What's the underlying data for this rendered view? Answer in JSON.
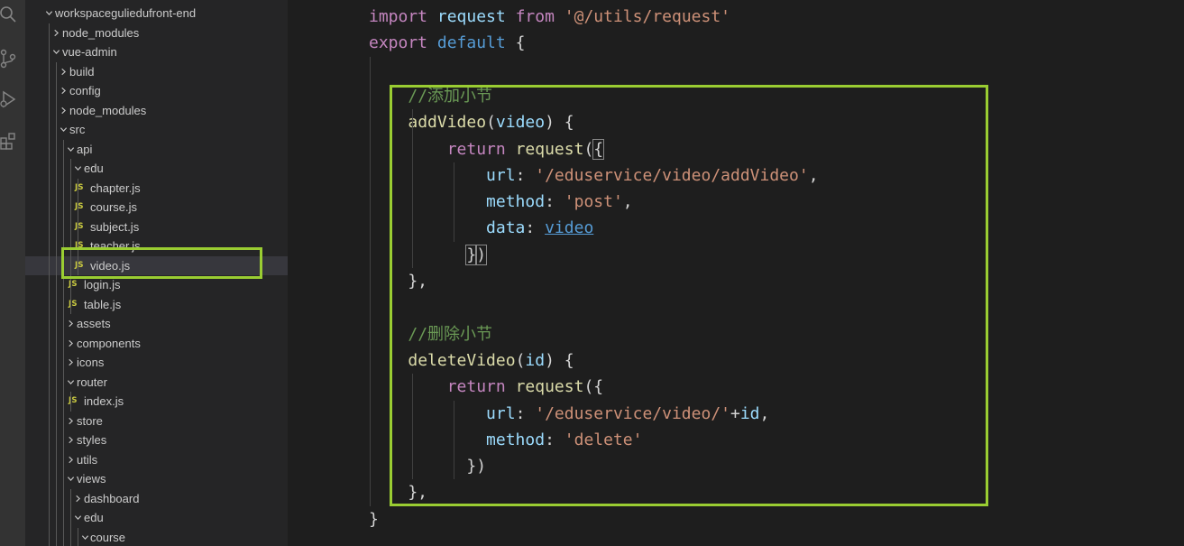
{
  "colors": {
    "highlight": "#9acd32",
    "js_badge": "#cbcb41",
    "sidebar_bg": "#252526",
    "editor_bg": "#1e1e1e"
  },
  "activity_bar": {
    "icons": [
      "search-icon",
      "source-control-icon",
      "run-debug-icon",
      "extensions-icon"
    ]
  },
  "explorer": {
    "items": [
      {
        "label": "workspaceguliedufront-end",
        "type": "folder",
        "expanded": true,
        "depth": 0
      },
      {
        "label": "node_modules",
        "type": "folder",
        "expanded": false,
        "depth": 1
      },
      {
        "label": "vue-admin",
        "type": "folder",
        "expanded": true,
        "depth": 1
      },
      {
        "label": "build",
        "type": "folder",
        "expanded": false,
        "depth": 2
      },
      {
        "label": "config",
        "type": "folder",
        "expanded": false,
        "depth": 2
      },
      {
        "label": "node_modules",
        "type": "folder",
        "expanded": false,
        "depth": 2
      },
      {
        "label": "src",
        "type": "folder",
        "expanded": true,
        "depth": 2
      },
      {
        "label": "api",
        "type": "folder",
        "expanded": true,
        "depth": 3
      },
      {
        "label": "edu",
        "type": "folder",
        "expanded": true,
        "depth": 4
      },
      {
        "label": "chapter.js",
        "type": "js",
        "depth": 5
      },
      {
        "label": "course.js",
        "type": "js",
        "depth": 5
      },
      {
        "label": "subject.js",
        "type": "js",
        "depth": 5
      },
      {
        "label": "teacher.js",
        "type": "js",
        "depth": 5
      },
      {
        "label": "video.js",
        "type": "js",
        "depth": 5,
        "selected": true
      },
      {
        "label": "login.js",
        "type": "js",
        "depth": 4
      },
      {
        "label": "table.js",
        "type": "js",
        "depth": 4
      },
      {
        "label": "assets",
        "type": "folder",
        "expanded": false,
        "depth": 3
      },
      {
        "label": "components",
        "type": "folder",
        "expanded": false,
        "depth": 3
      },
      {
        "label": "icons",
        "type": "folder",
        "expanded": false,
        "depth": 3
      },
      {
        "label": "router",
        "type": "folder",
        "expanded": true,
        "depth": 3
      },
      {
        "label": "index.js",
        "type": "js",
        "depth": 4
      },
      {
        "label": "store",
        "type": "folder",
        "expanded": false,
        "depth": 3
      },
      {
        "label": "styles",
        "type": "folder",
        "expanded": false,
        "depth": 3
      },
      {
        "label": "utils",
        "type": "folder",
        "expanded": false,
        "depth": 3
      },
      {
        "label": "views",
        "type": "folder",
        "expanded": true,
        "depth": 3
      },
      {
        "label": "dashboard",
        "type": "folder",
        "expanded": false,
        "depth": 4
      },
      {
        "label": "edu",
        "type": "folder",
        "expanded": true,
        "depth": 4
      },
      {
        "label": "course",
        "type": "folder",
        "expanded": true,
        "depth": 5
      }
    ],
    "js_badge_text": "JS"
  },
  "editor": {
    "active_line": 10,
    "lines": [
      {
        "n": "1",
        "tokens": [
          [
            "kw",
            "import"
          ],
          [
            "p",
            " "
          ],
          [
            "var",
            "request"
          ],
          [
            "p",
            " "
          ],
          [
            "kw",
            "from"
          ],
          [
            "p",
            " "
          ],
          [
            "str",
            "'@/utils/request'"
          ]
        ]
      },
      {
        "n": "2",
        "tokens": [
          [
            "kw",
            "export"
          ],
          [
            "p",
            " "
          ],
          [
            "kw",
            "default"
          ],
          [
            "p",
            " {"
          ]
        ]
      },
      {
        "n": "3",
        "tokens": []
      },
      {
        "n": "4",
        "tokens": [
          [
            "p",
            "    "
          ],
          [
            "cmt",
            "//添加小节"
          ]
        ]
      },
      {
        "n": "5",
        "tokens": [
          [
            "p",
            "    "
          ],
          [
            "fn",
            "addVideo"
          ],
          [
            "p",
            "("
          ],
          [
            "var",
            "video"
          ],
          [
            "p",
            ") {"
          ]
        ]
      },
      {
        "n": "6",
        "tokens": [
          [
            "p",
            "        "
          ],
          [
            "kw",
            "return"
          ],
          [
            "p",
            " "
          ],
          [
            "fn",
            "request"
          ],
          [
            "p",
            "("
          ],
          [
            "bm",
            "{"
          ]
        ]
      },
      {
        "n": "7",
        "tokens": [
          [
            "p",
            "            "
          ],
          [
            "var",
            "url"
          ],
          [
            "p",
            ": "
          ],
          [
            "str",
            "'/eduservice/video/addVideo'"
          ],
          [
            "p",
            ","
          ]
        ]
      },
      {
        "n": "8",
        "tokens": [
          [
            "p",
            "            "
          ],
          [
            "var",
            "method"
          ],
          [
            "p",
            ": "
          ],
          [
            "str",
            "'post'"
          ],
          [
            "p",
            ","
          ]
        ]
      },
      {
        "n": "9",
        "tokens": [
          [
            "p",
            "            "
          ],
          [
            "var",
            "data"
          ],
          [
            "p",
            ": "
          ],
          [
            "link",
            "video"
          ]
        ]
      },
      {
        "n": "10",
        "tokens": [
          [
            "p",
            "          "
          ],
          [
            "bm",
            "}"
          ],
          [
            "bm",
            ")"
          ]
        ]
      },
      {
        "n": "11",
        "tokens": [
          [
            "p",
            "    },"
          ]
        ]
      },
      {
        "n": "12",
        "tokens": []
      },
      {
        "n": "13",
        "tokens": [
          [
            "p",
            "    "
          ],
          [
            "cmt",
            "//删除小节"
          ]
        ]
      },
      {
        "n": "14",
        "tokens": [
          [
            "p",
            "    "
          ],
          [
            "fn",
            "deleteVideo"
          ],
          [
            "p",
            "("
          ],
          [
            "var",
            "id"
          ],
          [
            "p",
            ") {"
          ]
        ]
      },
      {
        "n": "15",
        "tokens": [
          [
            "p",
            "        "
          ],
          [
            "kw",
            "return"
          ],
          [
            "p",
            " "
          ],
          [
            "fn",
            "request"
          ],
          [
            "p",
            "({"
          ]
        ]
      },
      {
        "n": "16",
        "tokens": [
          [
            "p",
            "            "
          ],
          [
            "var",
            "url"
          ],
          [
            "p",
            ": "
          ],
          [
            "str",
            "'/eduservice/video/'"
          ],
          [
            "p",
            "+"
          ],
          [
            "var",
            "id"
          ],
          [
            "p",
            ","
          ]
        ]
      },
      {
        "n": "17",
        "tokens": [
          [
            "p",
            "            "
          ],
          [
            "var",
            "method"
          ],
          [
            "p",
            ": "
          ],
          [
            "str",
            "'delete'"
          ]
        ]
      },
      {
        "n": "18",
        "tokens": [
          [
            "p",
            "          })"
          ]
        ]
      },
      {
        "n": "19",
        "tokens": [
          [
            "p",
            "    },"
          ]
        ]
      },
      {
        "n": "20",
        "tokens": [
          [
            "p",
            "}"
          ]
        ]
      }
    ]
  }
}
